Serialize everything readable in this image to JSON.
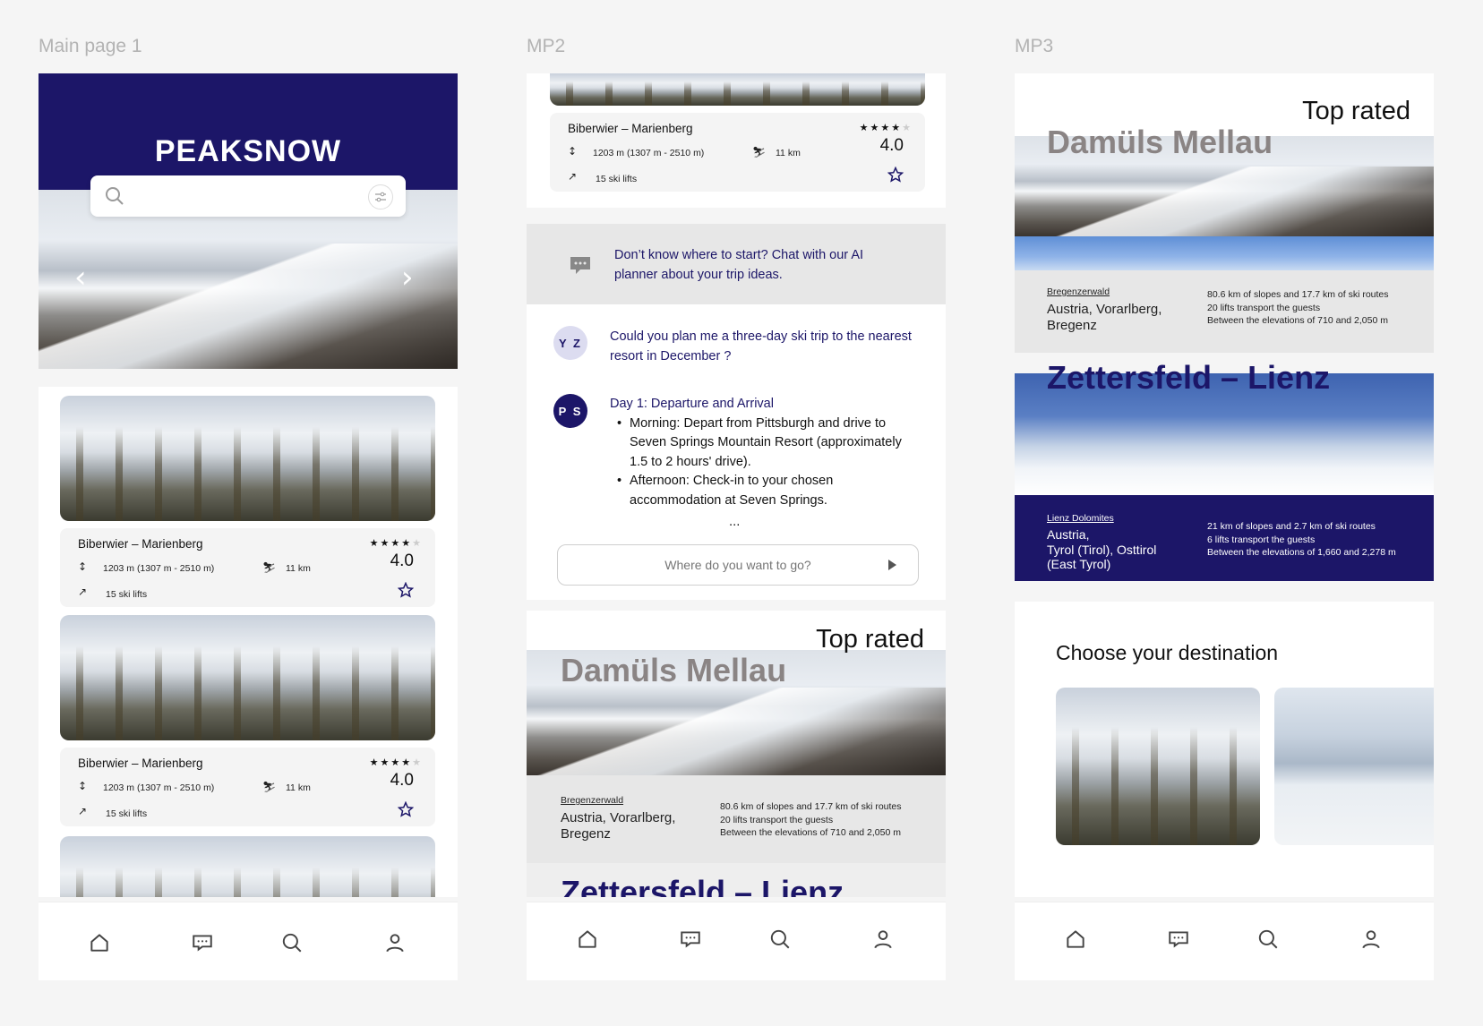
{
  "frames": {
    "main_label": "Main page 1",
    "mp2_label": "MP2",
    "mp3_label": "MP3"
  },
  "brand": "PEAKSNOW",
  "search": {
    "placeholder": ""
  },
  "resort_card": {
    "name": "Biberwier – Marienberg",
    "elevation": "1203 m (1307 m - 2510 m)",
    "distance": "11 km",
    "lifts": "15 ski lifts",
    "rating": "4.0",
    "stars_filled": 4,
    "stars_total": 5
  },
  "ai_banner": {
    "text": "Don’t know where to start?  Chat with our AI planner about your trip ideas."
  },
  "chat": {
    "user_initials": "Y Z",
    "user_message": "Could you plan me a three-day ski trip to the nearest resort in December ?",
    "bot_initials": "P S",
    "bot_heading": "Day 1: Departure and Arrival",
    "bot_items": [
      "Morning: Depart from Pittsburgh and drive to Seven Springs Mountain Resort (approximately 1.5 to 2 hours' drive).",
      "Afternoon: Check-in to your chosen accommodation at Seven Springs."
    ],
    "bot_more": "...",
    "input_placeholder": "Where do you want to go?"
  },
  "top_rated": {
    "title": "Top rated",
    "resorts": [
      {
        "name": "Damüls Mellau",
        "region_link": "Bregenzerwald",
        "region": "Austria, Vorarlberg, Bregenz",
        "stats": [
          "80.6 km of slopes and 17.7 km of ski routes",
          "20 lifts transport the guests",
          "Between the elevations of 710 and 2,050 m"
        ]
      },
      {
        "name": "Zettersfeld – Lienz",
        "region_link": "Lienz Dolomites",
        "region_lines": [
          "Austria,",
          "Tyrol (Tirol), Osttirol",
          "(East Tyrol)"
        ],
        "stats": [
          "21 km of slopes and 2.7 km of ski routes",
          "6 lifts transport the guests",
          "Between the elevations of 1,660 and 2,278 m"
        ]
      }
    ]
  },
  "mp2_partial_title": "Zettersfeld – Lienz",
  "choose": {
    "title": "Choose your destination"
  },
  "nav": [
    "home-icon",
    "chat-icon",
    "search-icon",
    "profile-icon"
  ],
  "colors": {
    "brand_navy": "#1c1668",
    "grey_panel": "#e7e7e7",
    "background": "#f5f5f5"
  }
}
